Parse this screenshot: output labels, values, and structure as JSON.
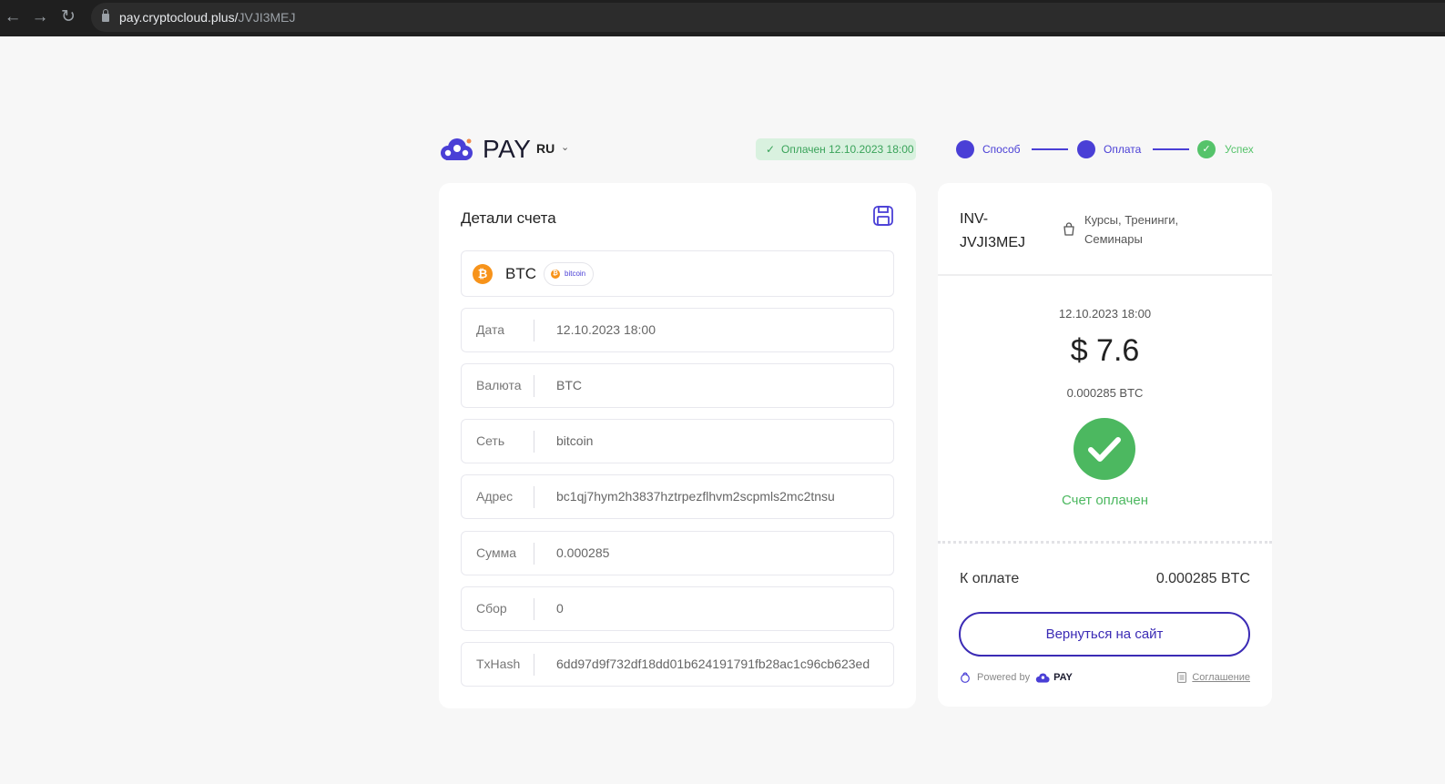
{
  "browser": {
    "url_host": "pay.cryptocloud.plus/",
    "url_path": "JVJI3MEJ"
  },
  "header": {
    "logo_text": "PAY",
    "language": "RU",
    "paid_badge": "Оплачен 12.10.2023 18:00",
    "steps": [
      {
        "label": "Способ",
        "state": "active"
      },
      {
        "label": "Оплата",
        "state": "active"
      },
      {
        "label": "Успех",
        "state": "done"
      }
    ]
  },
  "details": {
    "title": "Детали счета",
    "coin": {
      "symbol": "BTC",
      "network_badge": "bitcoin"
    },
    "rows": [
      {
        "label": "Дата",
        "value": "12.10.2023 18:00"
      },
      {
        "label": "Валюта",
        "value": "BTC"
      },
      {
        "label": "Сеть",
        "value": "bitcoin"
      },
      {
        "label": "Адрес",
        "value": "bc1qj7hym2h3837hztrpezflhvm2scpmls2mc2tnsu"
      },
      {
        "label": "Сумма",
        "value": "0.000285"
      },
      {
        "label": "Сбор",
        "value": "0"
      },
      {
        "label": "TxHash",
        "value": "6dd97d9f732df18dd01b624191791fb28ac1c96cb623ed"
      }
    ]
  },
  "invoice": {
    "id": "INV-JVJI3MEJ",
    "category": "Курсы, Тренинги, Семинары",
    "date": "12.10.2023 18:00",
    "amount": "$ 7.6",
    "crypto_amount": "0.000285 BTC",
    "status": "Счет оплачен",
    "to_pay_label": "К оплате",
    "to_pay_value": "0.000285 BTC",
    "back_button": "Вернуться на сайт",
    "powered_by": "Powered by",
    "powered_brand": "PAY",
    "agreement": "Соглашение"
  },
  "colors": {
    "brand": "#4a3fd6",
    "success": "#4cb860",
    "bitcoin": "#f7931a"
  }
}
